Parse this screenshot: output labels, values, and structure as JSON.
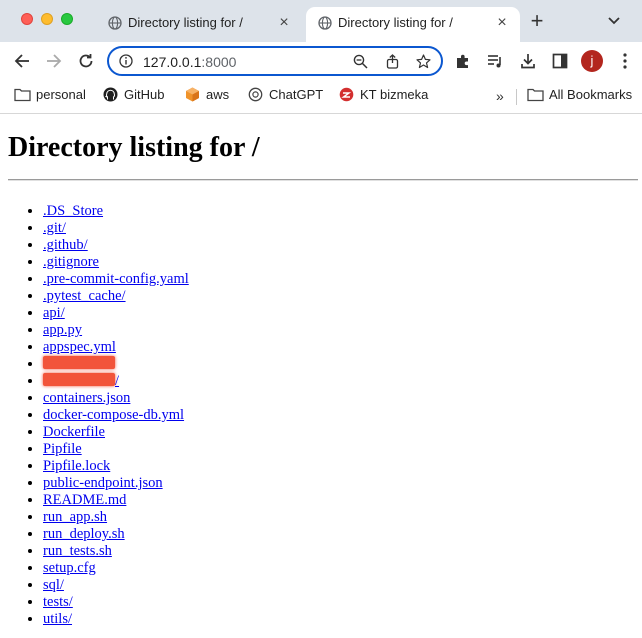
{
  "browser": {
    "tabs": [
      {
        "title": "Directory listing for /",
        "active": false
      },
      {
        "title": "Directory listing for /",
        "active": true
      }
    ],
    "new_tab_label": "+",
    "address": {
      "host": "127.0.0.1",
      "port": ":8000"
    },
    "profile_initial": "j",
    "bookmarks": [
      {
        "label": "personal",
        "icon": "folder-icon"
      },
      {
        "label": "GitHub",
        "icon": "github-icon"
      },
      {
        "label": "aws",
        "icon": "aws-icon"
      },
      {
        "label": "ChatGPT",
        "icon": "chatgpt-icon"
      },
      {
        "label": "KT bizmeka",
        "icon": "bizmeka-icon"
      }
    ],
    "bookmarks_more": "»",
    "all_bookmarks": "All Bookmarks",
    "colors": {
      "accent": "#0b57d0",
      "tabbar": "#dde3ea",
      "avatar": "#b3261e",
      "redaction": "#f2543a",
      "link": "#0000ee"
    }
  },
  "page": {
    "heading": "Directory listing for /",
    "entries": [
      ".DS_Store",
      ".git/",
      ".github/",
      ".gitignore",
      ".pre-commit-config.yaml",
      ".pytest_cache/",
      "api/",
      "app.py",
      "appspec.yml",
      {
        "redacted": true,
        "suffix": ""
      },
      {
        "redacted": true,
        "suffix": "/"
      },
      "containers.json",
      "docker-compose-db.yml",
      "Dockerfile",
      "Pipfile",
      "Pipfile.lock",
      "public-endpoint.json",
      "README.md",
      "run_app.sh",
      "run_deploy.sh",
      "run_tests.sh",
      "setup.cfg",
      "sql/",
      "tests/",
      "utils/"
    ]
  }
}
